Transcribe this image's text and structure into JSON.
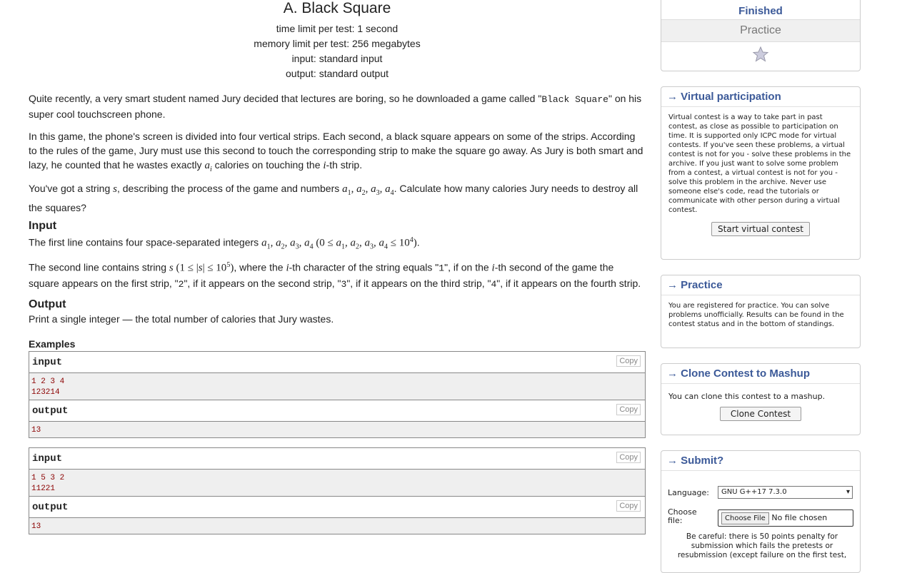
{
  "problem": {
    "title": "A. Black Square",
    "time_limit": "time limit per test: 1 second",
    "memory_limit": "memory limit per test: 256 megabytes",
    "input_type": "input: standard input",
    "output_type": "output: standard output"
  },
  "statement": {
    "p1_a": "Quite recently, a very smart student named Jury decided that lectures are boring, so he downloaded a game called \"",
    "p1_code": "Black Square",
    "p1_b": "\" on his super cool touchscreen phone.",
    "p2_a": "In this game, the phone's screen is divided into four vertical strips. Each second, a black square appears on some of the strips. According to the rules of the game, Jury must use this second to touch the corresponding strip to make the square go away. As Jury is both smart and lazy, he counted that he wastes exactly ",
    "p2_var": "a",
    "p2_sub": "i",
    "p2_b": " calories on touching the ",
    "p2_var2": "i",
    "p2_c": "-th strip.",
    "p3_a": "You've got a string ",
    "p3_var": "s",
    "p3_b": ", describing the process of the game and numbers ",
    "p3_vars": "a",
    "p3_c": ". Calculate how many calories Jury needs to destroy all the squares?",
    "input_title": "Input",
    "p4_a": "The first line contains four space-separated integers ",
    "p4_b": ".",
    "p5_a": "The second line contains string ",
    "p5_b": ", where the ",
    "p5_c": "-th character of the string equals \"",
    "p5_code1": "1",
    "p5_d": "\", if on the ",
    "p5_e": "-th second of the game the square appears on the first strip, \"",
    "p5_code2": "2",
    "p5_f": "\", if it appears on the second strip, \"",
    "p5_code3": "3",
    "p5_g": "\", if it appears on the third strip, \"",
    "p5_code4": "4",
    "p5_h": "\", if it appears on the fourth strip.",
    "output_title": "Output",
    "p6": "Print a single integer — the total number of calories that Jury wastes.",
    "examples_title": "Examples"
  },
  "examples": [
    {
      "input_label": "input",
      "input": "1 2 3 4\n123214",
      "output_label": "output",
      "output": "13",
      "copy": "Copy"
    },
    {
      "input_label": "input",
      "input": "1 5 3 2\n11221",
      "output_label": "output",
      "output": "13",
      "copy": "Copy"
    }
  ],
  "sidebar": {
    "status": "Finished",
    "mode": "Practice",
    "virtual": {
      "title": "→ Virtual participation",
      "text": "Virtual contest is a way to take part in past contest, as close as possible to participation on time. It is supported only ICPC mode for virtual contests. If you've seen these problems, a virtual contest is not for you - solve these problems in the archive. If you just want to solve some problem from a contest, a virtual contest is not for you - solve this problem in the archive. Never use someone else's code, read the tutorials or communicate with other person during a virtual contest.",
      "button": "Start virtual contest"
    },
    "practice": {
      "title": "→ Practice",
      "text": "You are registered for practice. You can solve problems unofficially. Results can be found in the contest status and in the bottom of standings."
    },
    "clone": {
      "title": "→ Clone Contest to Mashup",
      "text": "You can clone this contest to a mashup.",
      "button": "Clone Contest"
    },
    "submit": {
      "title": "→ Submit?",
      "language_label": "Language:",
      "language_value": "GNU G++17 7.3.0",
      "file_label": "Choose file:",
      "file_button": "Choose File",
      "file_status": "No file chosen",
      "warning": "Be careful: there is 50 points penalty for submission which fails the pretests or resubmission (except failure on the first test,"
    }
  }
}
